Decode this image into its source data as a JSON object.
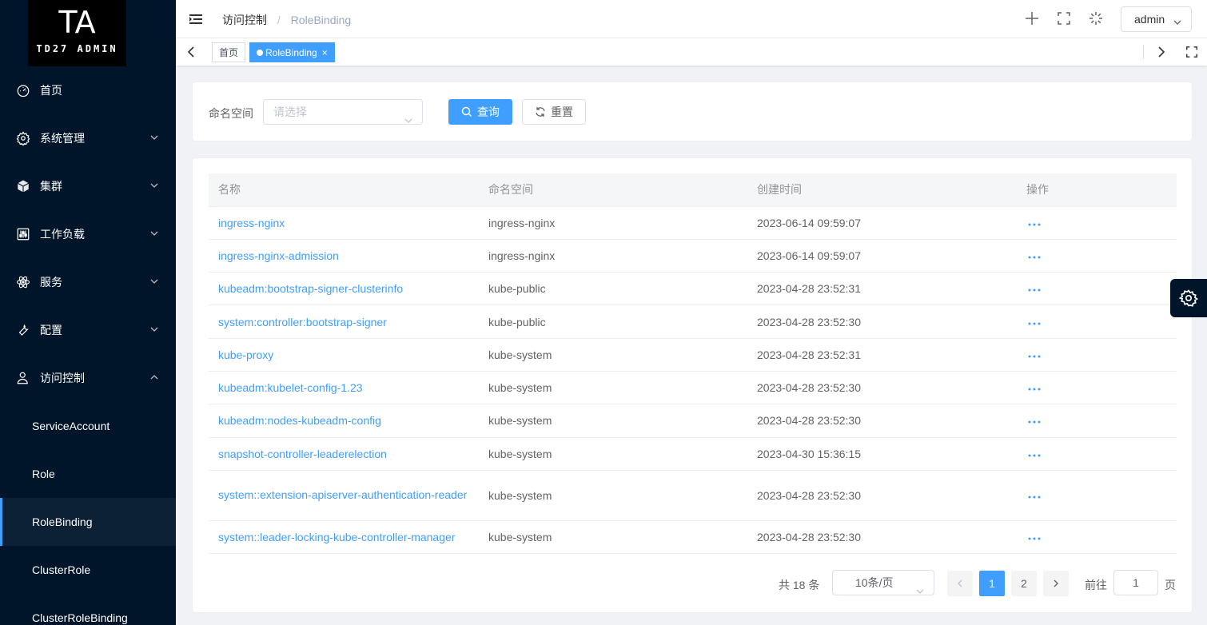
{
  "logo": {
    "big": "TA",
    "small": "TD27 ADMIN"
  },
  "sidebar": {
    "items": [
      {
        "label": "首页"
      },
      {
        "label": "系统管理"
      },
      {
        "label": "集群"
      },
      {
        "label": "工作负载"
      },
      {
        "label": "服务"
      },
      {
        "label": "配置"
      },
      {
        "label": "访问控制"
      }
    ],
    "sub_items": [
      {
        "label": "ServiceAccount"
      },
      {
        "label": "Role"
      },
      {
        "label": "RoleBinding"
      },
      {
        "label": "ClusterRole"
      },
      {
        "label": "ClusterRoleBinding"
      }
    ]
  },
  "header": {
    "breadcrumb": [
      "访问控制",
      "/",
      "RoleBinding"
    ],
    "user": "admin"
  },
  "tags": [
    {
      "label": "首页"
    },
    {
      "label": "RoleBinding",
      "close": "×"
    }
  ],
  "filter": {
    "label": "命名空间",
    "placeholder": "请选择",
    "query_label": "查询",
    "reset_label": "重置"
  },
  "table": {
    "headers": [
      "名称",
      "命名空间",
      "创建时间",
      "操作"
    ],
    "rows": [
      {
        "name": "ingress-nginx",
        "namespace": "ingress-nginx",
        "created": "2023-06-14 09:59:07"
      },
      {
        "name": "ingress-nginx-admission",
        "namespace": "ingress-nginx",
        "created": "2023-06-14 09:59:07"
      },
      {
        "name": "kubeadm:bootstrap-signer-clusterinfo",
        "namespace": "kube-public",
        "created": "2023-04-28 23:52:31"
      },
      {
        "name": "system:controller:bootstrap-signer",
        "namespace": "kube-public",
        "created": "2023-04-28 23:52:30"
      },
      {
        "name": "kube-proxy",
        "namespace": "kube-system",
        "created": "2023-04-28 23:52:31"
      },
      {
        "name": "kubeadm:kubelet-config-1.23",
        "namespace": "kube-system",
        "created": "2023-04-28 23:52:30"
      },
      {
        "name": "kubeadm:nodes-kubeadm-config",
        "namespace": "kube-system",
        "created": "2023-04-28 23:52:30"
      },
      {
        "name": "snapshot-controller-leaderelection",
        "namespace": "kube-system",
        "created": "2023-04-30 15:36:15"
      },
      {
        "name": "system::extension-apiserver-authentication-reader",
        "namespace": "kube-system",
        "created": "2023-04-28 23:52:30"
      },
      {
        "name": "system::leader-locking-kube-controller-manager",
        "namespace": "kube-system",
        "created": "2023-04-28 23:52:30"
      }
    ]
  },
  "pagination": {
    "total": "共 18 条",
    "page_size": "10条/页",
    "pages": [
      "1",
      "2"
    ],
    "current": "1",
    "goto_label": "前往",
    "goto_value": "1",
    "goto_unit": "页"
  },
  "colors": {
    "accent": "#409eff",
    "sidebar": "#001529"
  }
}
